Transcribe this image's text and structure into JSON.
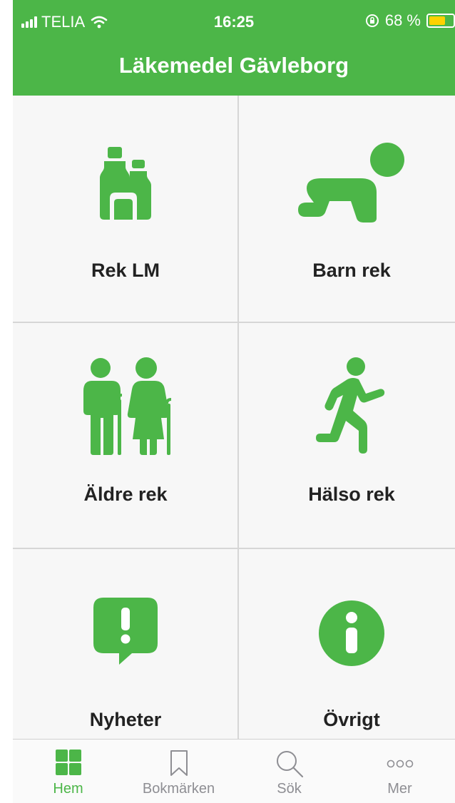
{
  "status_bar": {
    "carrier": "TELIA",
    "time": "16:25",
    "battery_percent": "68 %",
    "battery_level": 0.68
  },
  "header": {
    "title": "Läkemedel Gävleborg"
  },
  "tiles": [
    {
      "label": "Rek LM",
      "icon": "medicine-bottles-icon"
    },
    {
      "label": "Barn rek",
      "icon": "crawling-baby-icon"
    },
    {
      "label": "Äldre rek",
      "icon": "elderly-couple-icon"
    },
    {
      "label": "Hälso rek",
      "icon": "running-person-icon"
    },
    {
      "label": "Nyheter",
      "icon": "exclamation-speech-bubble-icon"
    },
    {
      "label": "Övrigt",
      "icon": "info-circle-icon"
    }
  ],
  "tab_bar": {
    "items": [
      {
        "label": "Hem",
        "icon": "grid-icon",
        "active": true
      },
      {
        "label": "Bokmärken",
        "icon": "bookmark-icon",
        "active": false
      },
      {
        "label": "Sök",
        "icon": "search-icon",
        "active": false
      },
      {
        "label": "Mer",
        "icon": "more-icon",
        "active": false
      }
    ]
  },
  "colors": {
    "brand": "#4cb648",
    "inactive": "#8e8e93",
    "background": "#f7f7f7"
  }
}
